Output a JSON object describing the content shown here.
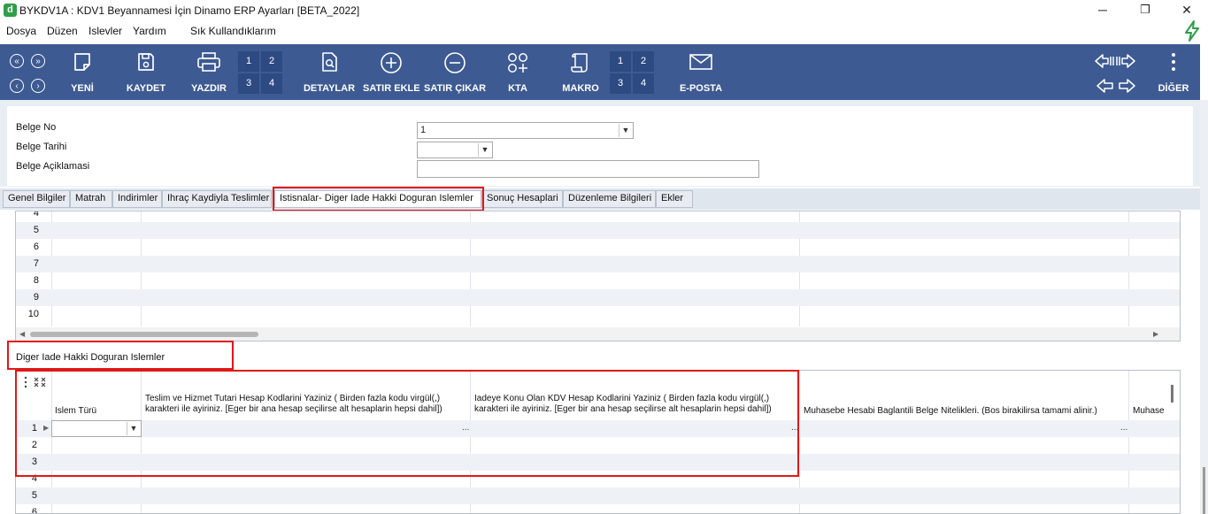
{
  "window": {
    "app_icon_letter": "d",
    "title": "BYKDV1A : KDV1 Beyannamesi İçin Dinamo ERP Ayarları [BETA_2022]",
    "controls": [
      "─",
      "❐",
      "✕"
    ]
  },
  "menu": {
    "items": [
      "Dosya",
      "Düzen",
      "Islevler",
      "Yardım",
      "Sık Kullandıklarım"
    ]
  },
  "toolbar": {
    "yeni": "YENİ",
    "kaydet": "KAYDET",
    "yazdir": "YAZDIR",
    "print_pages": [
      "1",
      "2",
      "3",
      "4"
    ],
    "detaylar": "DETAYLAR",
    "satir_ekle": "SATIR EKLE",
    "satir_cikar": "SATIR ÇIKAR",
    "kta": "KTA",
    "makro": "MAKRO",
    "macro_slots": [
      "1",
      "2",
      "3",
      "4"
    ],
    "eposta": "E-POSTA",
    "diger": "DİĞER",
    "nav_glyphs": [
      "«",
      "»",
      "‹",
      "›"
    ]
  },
  "form": {
    "belge_no_label": "Belge No",
    "belge_no_value": "1",
    "belge_tarihi_label": "Belge Tarihi",
    "belge_tarihi_value": "",
    "belge_aciklamasi_label": "Belge Açiklamasi",
    "belge_aciklamasi_value": ""
  },
  "tabs": [
    {
      "label": "Genel Bilgiler"
    },
    {
      "label": "Matrah"
    },
    {
      "label": "Indirimler"
    },
    {
      "label": "Ihraç Kaydiyla Teslimler"
    },
    {
      "label": "Istisnalar- Diger Iade Hakki Doguran Islemler"
    },
    {
      "label": "Sonuç Hesaplari"
    },
    {
      "label": "Düzenleme Bilgileri"
    },
    {
      "label": "Ekler"
    }
  ],
  "active_tab": "Istisnalar- Diger Iade Hakki Doguran Islemler",
  "upper_grid": {
    "rows": [
      "4",
      "5",
      "6",
      "7",
      "8",
      "9",
      "10"
    ]
  },
  "lower_section": {
    "title": "Diger Iade Hakki Doguran Islemler",
    "columns": [
      "Islem Türü",
      "Teslim ve Hizmet Tutari Hesap Kodlarini Yaziniz ( Birden fazla kodu virgül(,) karakteri ile ayiriniz. [Eger bir ana hesap seçilirse alt hesaplarin hepsi dahil])",
      "Iadeye Konu Olan KDV Hesap Kodlarini Yaziniz ( Birden fazla kodu virgül(,) karakteri ile ayiriniz. [Eger bir ana hesap seçilirse alt hesaplarin hepsi dahil])",
      "Muhasebe Hesabi Baglantili Belge Nitelikleri. (Bos birakilirsa tamami alinir.)",
      "Muhase"
    ],
    "rows": [
      "1",
      "2",
      "3",
      "4",
      "5",
      "6"
    ],
    "ellipsis": "..."
  },
  "colors": {
    "toolbar_bg": "#3d5a93",
    "highlight_red": "#e01818",
    "app_green": "#2e9e49"
  }
}
